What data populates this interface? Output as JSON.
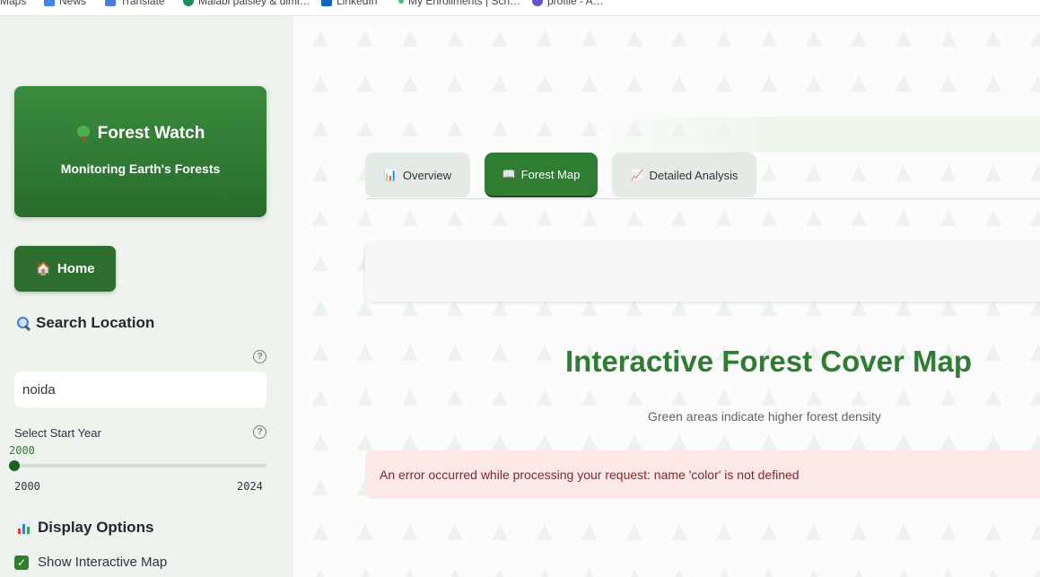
{
  "bookmarks": [
    {
      "label": "Maps",
      "icon": "maps-icon"
    },
    {
      "label": "News",
      "icon": "news-icon"
    },
    {
      "label": "Translate",
      "icon": "translate-icon"
    },
    {
      "label": "Malabi paisley & dimi…",
      "icon": "site-icon"
    },
    {
      "label": "LinkedIn",
      "icon": "linkedin-icon"
    },
    {
      "label": "My Enrollments | Sch…",
      "icon": "enroll-icon"
    },
    {
      "label": "profile - A…",
      "icon": "profile-icon"
    }
  ],
  "sidebar": {
    "brand_title": "Forest Watch",
    "brand_subtitle": "Monitoring Earth's Forests",
    "home_label": "Home",
    "search_heading": "Search Location",
    "search_value": "noida",
    "start_year_label": "Select Start Year",
    "start_year_value": "2000",
    "slider_min": "2000",
    "slider_max": "2024",
    "display_heading": "Display Options",
    "show_map_label": "Show Interactive Map",
    "show_map_checked": true
  },
  "tabs": [
    {
      "label": "Overview",
      "icon": "bar-chart-icon",
      "active": false
    },
    {
      "label": "Forest Map",
      "icon": "map-book-icon",
      "active": true
    },
    {
      "label": "Detailed Analysis",
      "icon": "trend-chart-icon",
      "active": false
    }
  ],
  "main": {
    "map_title": "Interactive Forest Cover Map",
    "map_subtitle": "Green areas indicate higher forest density",
    "error_message": "An error occurred while processing your request: name 'color' is not defined"
  },
  "colors": {
    "brand_green": "#2e7d32",
    "sidebar_bg": "#eef3ee",
    "error_bg": "#fde8e8",
    "error_text": "#7d2a2a"
  }
}
